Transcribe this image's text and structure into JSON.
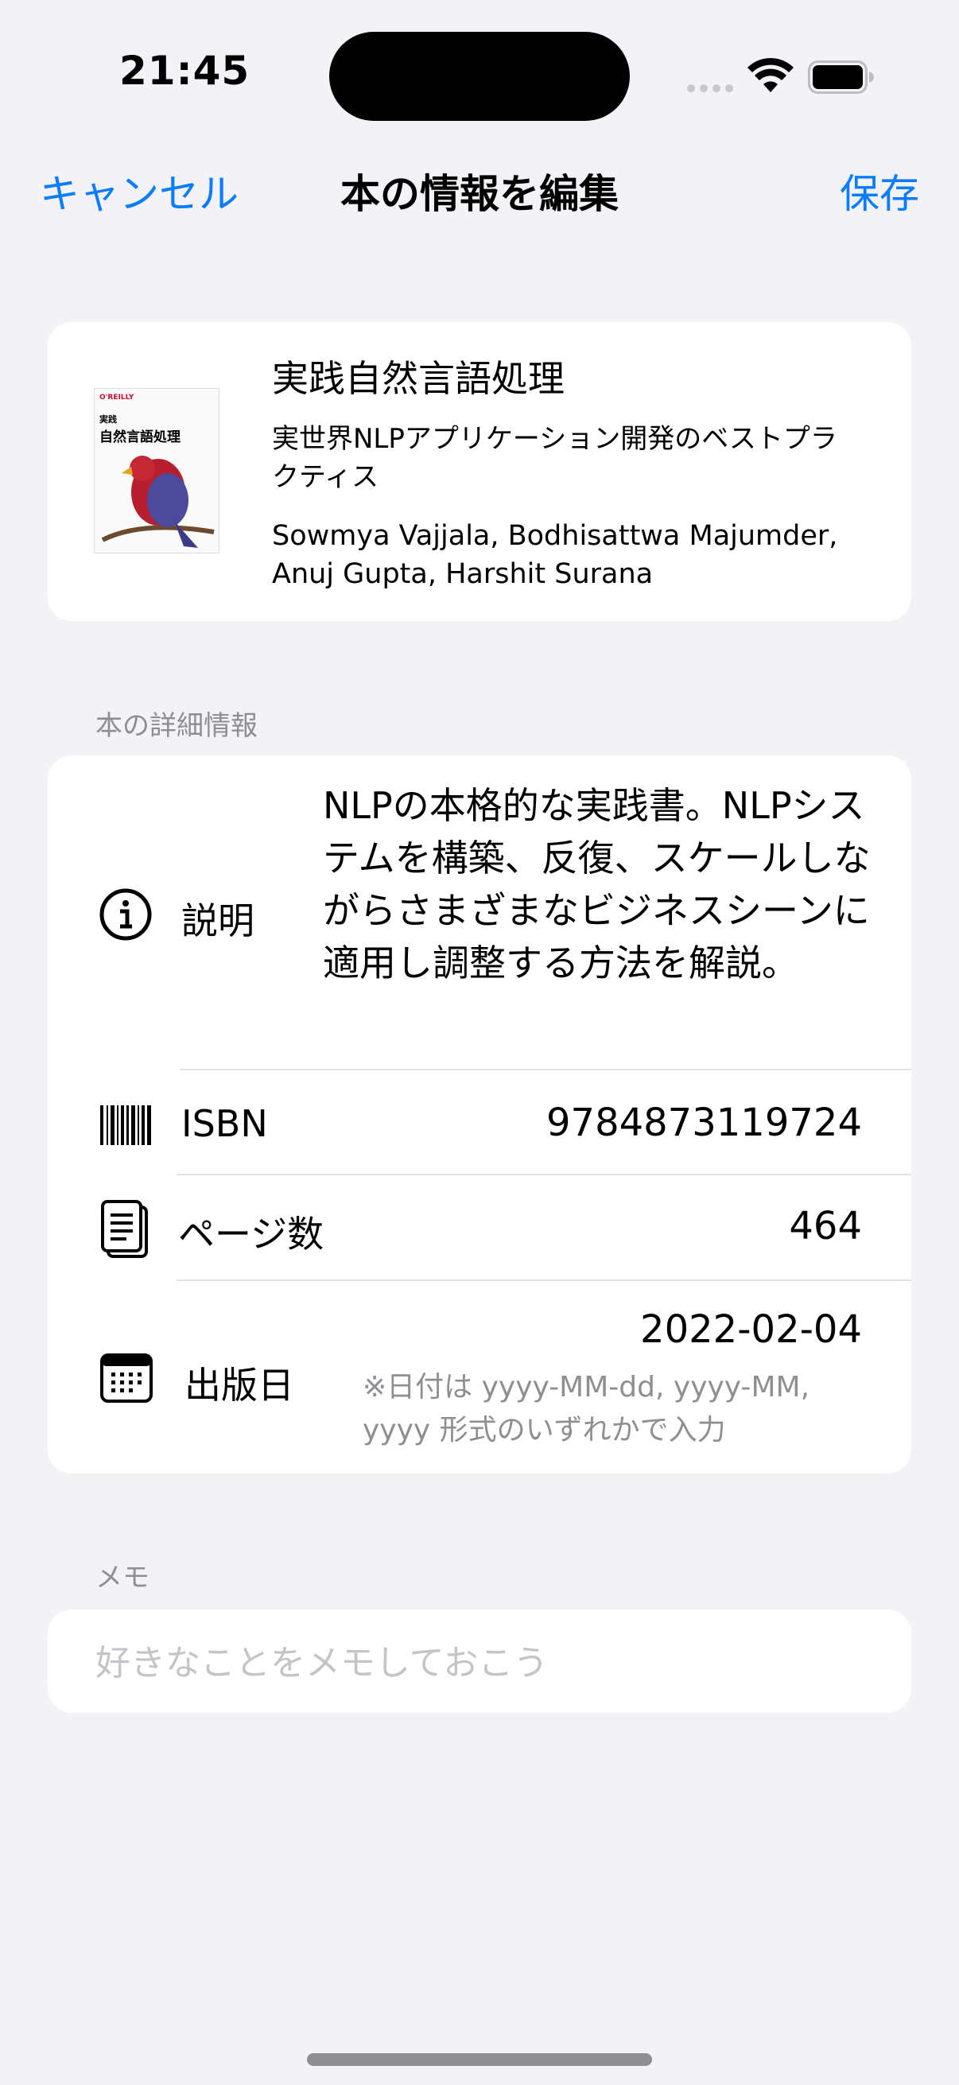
{
  "status": {
    "time": "21:45"
  },
  "nav": {
    "cancel": "キャンセル",
    "title": "本の情報を編集",
    "save": "保存"
  },
  "book": {
    "title": "実践自然言語処理",
    "subtitle": "実世界NLPアプリケーション開発のベストプラクティス",
    "authors": "Sowmya Vajjala, Bodhisattwa Majumder, Anuj Gupta, Harshit Surana",
    "cover": {
      "publisher": "O'REILLY",
      "series": "実践",
      "title": "自然言語処理"
    }
  },
  "details": {
    "section_label": "本の詳細情報",
    "description_label": "説明",
    "description_value": "NLPの本格的な実践書。NLPシステムを構築、反復、スケールしながらさまざまなビジネスシーンに適用し調整する方法を解説。",
    "isbn_label": "ISBN",
    "isbn_value": "9784873119724",
    "pages_label": "ページ数",
    "pages_value": "464",
    "date_label": "出版日",
    "date_value": "2022-02-04",
    "date_hint": "※日付は yyyy-MM-dd, yyyy-MM, yyyy 形式のいずれかで入力"
  },
  "memo": {
    "section_label": "メモ",
    "placeholder": "好きなことをメモしておこう"
  },
  "colors": {
    "accent": "#0a7cff",
    "background": "#f2f2f7",
    "secondary_text": "#8e8e93"
  }
}
